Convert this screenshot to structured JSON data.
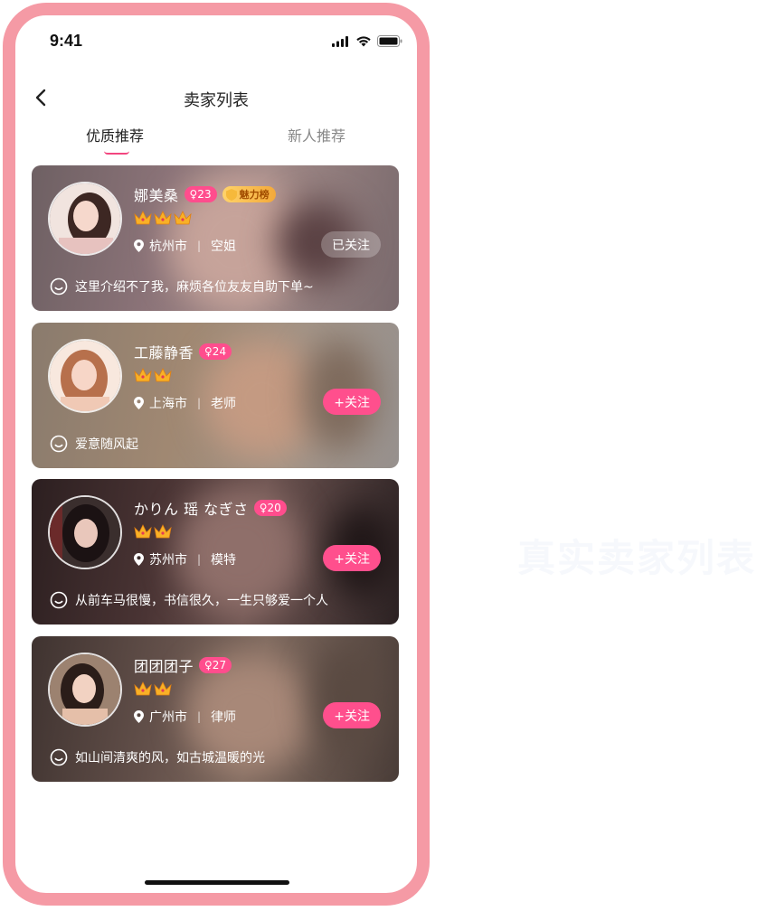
{
  "status_bar": {
    "time": "9:41"
  },
  "nav": {
    "title": "卖家列表"
  },
  "tabs": [
    {
      "label": "优质推荐",
      "active": true
    },
    {
      "label": "新人推荐",
      "active": false
    }
  ],
  "sellers": [
    {
      "name": "娜美桑",
      "age": "♀23",
      "charm_badge": "魅力榜",
      "crowns": 3,
      "city": "杭州市",
      "job": "空姐",
      "follow_label": "已关注",
      "followed": true,
      "bio": "这里介绍不了我，麻烦各位友友自助下单~"
    },
    {
      "name": "工藤静香",
      "age": "♀24",
      "crowns": 2,
      "city": "上海市",
      "job": "老师",
      "follow_label": "+关注",
      "followed": false,
      "bio": "爱意随风起"
    },
    {
      "name": "かりん 瑶 なぎさ",
      "age": "♀20",
      "crowns": 2,
      "city": "苏州市",
      "job": "模特",
      "follow_label": "+关注",
      "followed": false,
      "bio": "从前车马很慢，书信很久，一生只够爱一个人"
    },
    {
      "name": "团团团子",
      "age": "♀27",
      "crowns": 2,
      "city": "广州市",
      "job": "律师",
      "follow_label": "+关注",
      "followed": false,
      "bio": "如山间清爽的风，如古城温暖的光"
    }
  ],
  "watermark": "真实卖家列表",
  "colors": {
    "accent": "#ff4f8d",
    "frame": "#f59aa5",
    "gold": "#f3a93a"
  }
}
